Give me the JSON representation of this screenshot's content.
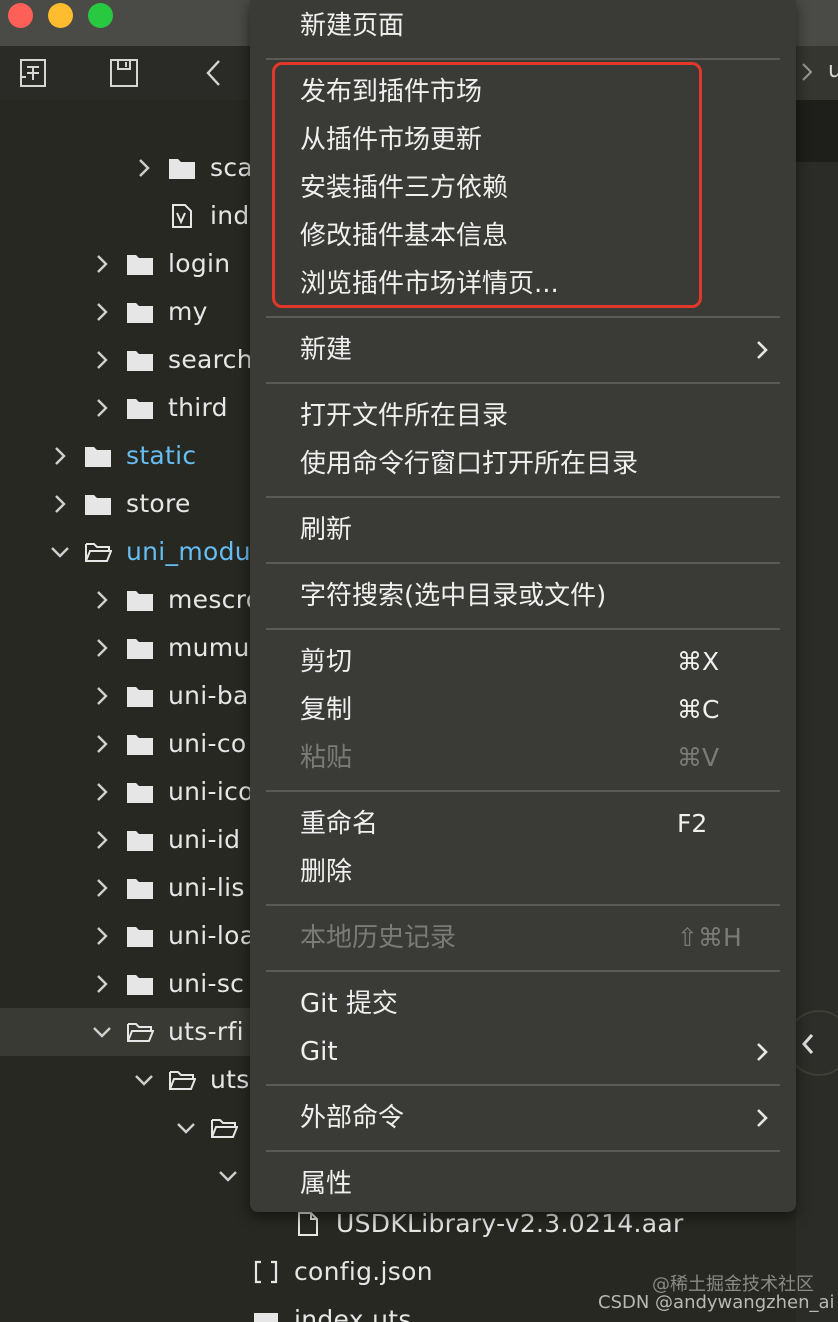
{
  "toolbar": {
    "icons": [
      "new-file-icon",
      "save-icon",
      "back-icon"
    ]
  },
  "tree": {
    "items": [
      {
        "label": "sca",
        "kind": "folder",
        "expanded": false
      },
      {
        "label": "ind",
        "kind": "vue-file"
      },
      {
        "label": "login",
        "kind": "folder",
        "expanded": false
      },
      {
        "label": "my",
        "kind": "folder",
        "expanded": false
      },
      {
        "label": "search",
        "kind": "folder",
        "expanded": false
      },
      {
        "label": "third",
        "kind": "folder",
        "expanded": false
      },
      {
        "label": "static",
        "kind": "folder",
        "expanded": false,
        "color": "#66bdf2"
      },
      {
        "label": "store",
        "kind": "folder",
        "expanded": false
      },
      {
        "label": "uni_modu",
        "kind": "folder",
        "expanded": true,
        "color": "#66bdf2"
      },
      {
        "label": "mescro",
        "kind": "folder",
        "expanded": false
      },
      {
        "label": "mumu",
        "kind": "folder",
        "expanded": false
      },
      {
        "label": "uni-ba",
        "kind": "folder",
        "expanded": false
      },
      {
        "label": "uni-co",
        "kind": "folder",
        "expanded": false
      },
      {
        "label": "uni-ico",
        "kind": "folder",
        "expanded": false
      },
      {
        "label": "uni-id",
        "kind": "folder",
        "expanded": false
      },
      {
        "label": "uni-lis",
        "kind": "folder",
        "expanded": false
      },
      {
        "label": "uni-loa",
        "kind": "folder",
        "expanded": false
      },
      {
        "label": "uni-sc",
        "kind": "folder",
        "expanded": false
      },
      {
        "label": "uts-rfi",
        "kind": "folder",
        "expanded": true,
        "selected": true
      },
      {
        "label": "uts",
        "kind": "folder",
        "expanded": true
      },
      {
        "label": "",
        "kind": "folder",
        "expanded": true
      },
      {
        "label": "",
        "kind": "folder",
        "expanded": true
      },
      {
        "label": "USDKLibrary-v2.3.0214.aar",
        "kind": "file"
      },
      {
        "label": "config.json",
        "kind": "json-file"
      },
      {
        "label": "index.uts",
        "kind": "uts-file"
      }
    ]
  },
  "editor": {
    "tab_label": "u"
  },
  "context_menu": {
    "items": [
      {
        "label": "新建页面"
      },
      {
        "separator": true
      },
      {
        "label": "发布到插件市场"
      },
      {
        "label": "从插件市场更新"
      },
      {
        "label": "安装插件三方依赖"
      },
      {
        "label": "修改插件基本信息"
      },
      {
        "label": "浏览插件市场详情页..."
      },
      {
        "separator": true
      },
      {
        "label": "新建",
        "submenu": true
      },
      {
        "separator": true
      },
      {
        "label": "打开文件所在目录"
      },
      {
        "label": "使用命令行窗口打开所在目录"
      },
      {
        "separator": true
      },
      {
        "label": "刷新"
      },
      {
        "separator": true
      },
      {
        "label": "字符搜索(选中目录或文件)"
      },
      {
        "separator": true
      },
      {
        "label": "剪切",
        "shortcut": "⌘X"
      },
      {
        "label": "复制",
        "shortcut": "⌘C"
      },
      {
        "label": "粘贴",
        "shortcut": "⌘V",
        "disabled": true
      },
      {
        "separator": true
      },
      {
        "label": "重命名",
        "shortcut": "F2"
      },
      {
        "label": "删除"
      },
      {
        "separator": true
      },
      {
        "label": "本地历史记录",
        "shortcut": "⇧⌘H",
        "disabled": true
      },
      {
        "separator": true
      },
      {
        "label": "Git 提交"
      },
      {
        "label": "Git",
        "submenu": true
      },
      {
        "separator": true
      },
      {
        "label": "外部命令",
        "submenu": true
      },
      {
        "separator": true
      },
      {
        "label": "属性"
      }
    ]
  },
  "highlight_color": "#e3372b",
  "watermark": {
    "line1": "@稀土掘金技术社区",
    "line2": "CSDN @andywangzhen_ai"
  }
}
